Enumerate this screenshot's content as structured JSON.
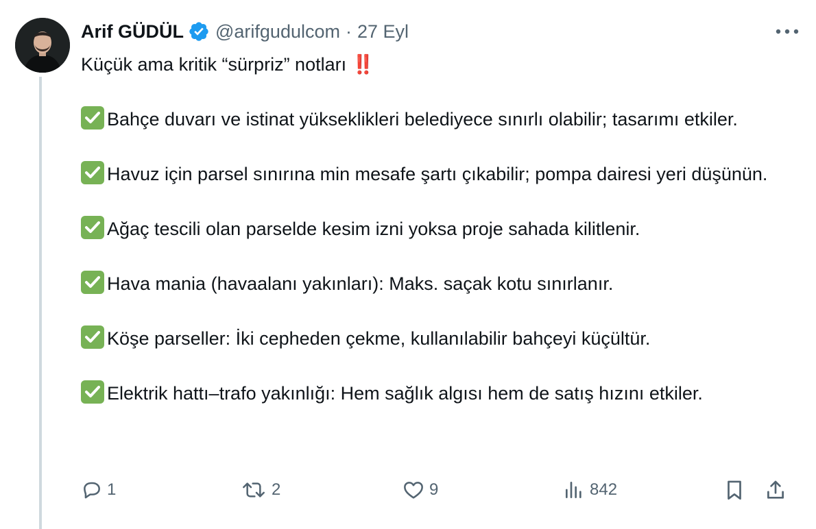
{
  "author": {
    "display_name": "Arif GÜDÜL",
    "handle": "@arifgudulcom",
    "separator": "·",
    "date": "27 Eyl",
    "verified_icon": "verified-badge-icon",
    "verified_color": "#1d9bf0"
  },
  "tweet": {
    "intro": "Küçük ama kritik “sürpriz” notları",
    "intro_emoji": "‼️",
    "items": [
      "Bahçe duvarı ve istinat yükseklikleri belediyece sınırlı olabilir; tasarımı etkiler.",
      "Havuz için parsel sınırına min mesafe şartı çıkabilir; pompa dairesi yeri düşünün.",
      "Ağaç tescili olan parselde kesim izni yoksa proje sahada kilitlenir.",
      "Hava mania (havaalanı yakınları): Maks. saçak kotu sınırlanır.",
      "Köşe parseller: İki cepheden çekme, kullanılabilir bahçeyi küçültür.",
      "Elektrik hattı–trafo yakınlığı: Hem sağlık algısı hem de satış hızını etkiler."
    ],
    "item_icon": "check-mark-button-icon"
  },
  "actions": {
    "reply_count": "1",
    "retweet_count": "2",
    "like_count": "9",
    "views_count": "842"
  },
  "colors": {
    "text": "#0f1419",
    "muted": "#536471",
    "thread_line": "#cfd9de",
    "check_green": "#77b255"
  }
}
